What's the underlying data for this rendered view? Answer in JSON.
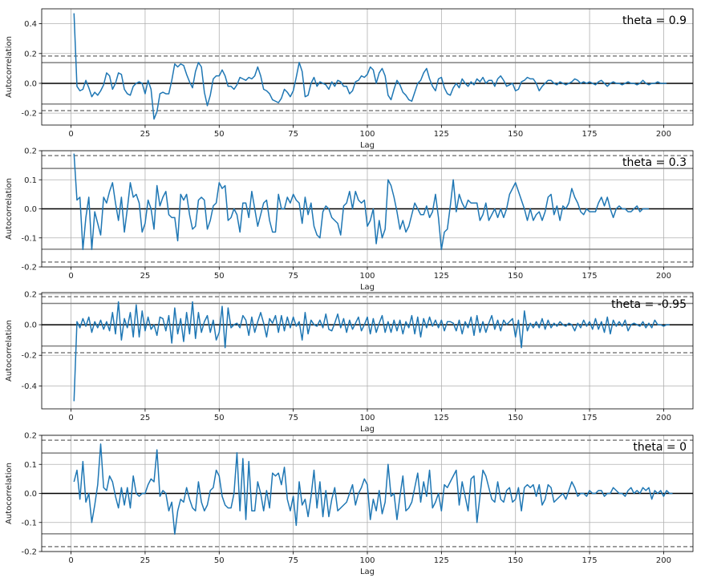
{
  "chart_data": [
    {
      "type": "line",
      "annotation": "theta = 0.9",
      "xlabel": "Lag",
      "ylabel": "Autocorrelation",
      "xlim": [
        -9.9,
        209.9
      ],
      "ylim": [
        -0.28,
        0.5
      ],
      "xticks": [
        "0",
        "25",
        "50",
        "75",
        "100",
        "125",
        "150",
        "175",
        "200"
      ],
      "yticks": [
        "-0.2",
        "0.0",
        "0.2",
        "0.4"
      ],
      "ytick_values": [
        -0.2,
        0.0,
        0.2,
        0.4
      ],
      "confidence_lines": {
        "solid": 0.139,
        "dashed": 0.183
      },
      "grid": true,
      "series": [
        {
          "color": "#1f77b4",
          "values": [
            0.47,
            -0.02,
            -0.05,
            -0.04,
            0.02,
            -0.03,
            -0.09,
            -0.06,
            -0.08,
            -0.05,
            -0.01,
            0.07,
            0.05,
            -0.04,
            0.0,
            0.07,
            0.06,
            -0.04,
            -0.07,
            -0.08,
            -0.02,
            0.0,
            0.01,
            0.0,
            -0.07,
            0.02,
            -0.04,
            -0.24,
            -0.19,
            -0.07,
            -0.06,
            -0.07,
            -0.07,
            0.02,
            0.13,
            0.11,
            0.13,
            0.12,
            0.06,
            0.01,
            -0.03,
            0.08,
            0.14,
            0.11,
            -0.06,
            -0.15,
            -0.08,
            0.03,
            0.05,
            0.05,
            0.09,
            0.05,
            -0.02,
            -0.02,
            -0.04,
            -0.01,
            0.04,
            0.03,
            0.02,
            0.04,
            0.03,
            0.05,
            0.11,
            0.05,
            -0.04,
            -0.05,
            -0.07,
            -0.11,
            -0.12,
            -0.13,
            -0.1,
            -0.04,
            -0.06,
            -0.09,
            -0.05,
            0.04,
            0.14,
            0.08,
            -0.09,
            -0.08,
            0.0,
            0.04,
            -0.02,
            0.01,
            0.0,
            -0.01,
            -0.04,
            0.01,
            -0.02,
            0.02,
            0.01,
            -0.02,
            -0.02,
            -0.07,
            -0.05,
            0.01,
            0.02,
            0.05,
            0.04,
            0.06,
            0.11,
            0.09,
            0.0,
            0.07,
            0.1,
            0.05,
            -0.08,
            -0.11,
            -0.04,
            0.02,
            -0.01,
            -0.06,
            -0.08,
            -0.11,
            -0.12,
            -0.06,
            0.0,
            0.02,
            0.07,
            0.1,
            0.03,
            -0.02,
            -0.05,
            0.03,
            0.04,
            -0.03,
            -0.07,
            -0.08,
            -0.03,
            0.0,
            -0.03,
            0.03,
            0.0,
            -0.02,
            0.01,
            -0.01,
            0.03,
            0.01,
            0.04,
            0.0,
            0.02,
            0.02,
            -0.02,
            0.03,
            0.05,
            0.02,
            -0.02,
            -0.01,
            0.0,
            -0.05,
            -0.04,
            0.01,
            0.02,
            0.04,
            0.03,
            0.03,
            0.0,
            -0.05,
            -0.02,
            0.0,
            0.02,
            0.02,
            0.0,
            -0.01,
            0.01,
            0.0,
            -0.01,
            0.0,
            0.01,
            0.03,
            0.02,
            0.0,
            0.01,
            0.0,
            0.01,
            0.0,
            -0.01,
            0.01,
            0.02,
            0.0,
            -0.02,
            0.0,
            0.01,
            0.0,
            0.0,
            -0.01,
            0.0,
            0.01,
            0.0,
            0.0,
            -0.01,
            0.0,
            0.02,
            0.0,
            -0.01,
            0.0,
            0.0,
            0.01,
            0.0,
            0.0,
            0.0
          ]
        }
      ]
    },
    {
      "type": "line",
      "annotation": "theta = 0.3",
      "xlabel": "Lag",
      "ylabel": "Autocorrelation",
      "xlim": [
        -9.9,
        209.9
      ],
      "ylim": [
        -0.2,
        0.2
      ],
      "xticks": [
        "0",
        "25",
        "50",
        "75",
        "100",
        "125",
        "150",
        "175",
        "200"
      ],
      "yticks": [
        "-0.2",
        "-0.1",
        "0.0",
        "0.1",
        "0.2"
      ],
      "ytick_values": [
        -0.2,
        -0.1,
        0.0,
        0.1,
        0.2
      ],
      "confidence_lines": {
        "solid": 0.139,
        "dashed": 0.183
      },
      "grid": true,
      "series": [
        {
          "color": "#1f77b4",
          "values": [
            0.19,
            0.03,
            0.04,
            -0.14,
            -0.03,
            0.04,
            -0.14,
            -0.01,
            -0.05,
            -0.09,
            0.04,
            0.02,
            0.06,
            0.09,
            0.02,
            -0.04,
            0.04,
            -0.08,
            0.0,
            0.09,
            0.04,
            0.05,
            0.02,
            -0.08,
            -0.05,
            0.03,
            0.0,
            -0.07,
            0.08,
            0.01,
            0.04,
            0.06,
            -0.02,
            -0.03,
            -0.03,
            -0.11,
            0.05,
            0.03,
            0.05,
            -0.02,
            -0.07,
            -0.06,
            0.03,
            0.04,
            0.03,
            -0.07,
            -0.04,
            0.01,
            0.02,
            0.09,
            0.07,
            0.08,
            -0.04,
            -0.03,
            0.0,
            -0.02,
            -0.08,
            0.02,
            0.02,
            -0.03,
            0.06,
            0.0,
            -0.06,
            -0.02,
            0.02,
            0.03,
            -0.04,
            -0.08,
            -0.08,
            0.05,
            0.0,
            0.0,
            0.04,
            0.02,
            0.05,
            0.03,
            0.02,
            -0.05,
            0.04,
            -0.02,
            0.02,
            -0.06,
            -0.09,
            -0.1,
            -0.01,
            0.01,
            0.0,
            -0.03,
            -0.04,
            -0.05,
            -0.09,
            0.01,
            0.02,
            0.06,
            0.0,
            0.06,
            0.03,
            0.02,
            0.03,
            -0.06,
            -0.04,
            0.0,
            -0.12,
            -0.04,
            -0.1,
            -0.07,
            0.1,
            0.08,
            0.04,
            -0.01,
            -0.07,
            -0.04,
            -0.08,
            -0.06,
            -0.02,
            0.02,
            0.0,
            -0.02,
            -0.02,
            0.01,
            -0.03,
            -0.01,
            0.05,
            -0.03,
            -0.14,
            -0.08,
            -0.07,
            0.01,
            0.1,
            -0.01,
            0.05,
            0.02,
            0.0,
            0.03,
            0.02,
            0.02,
            0.02,
            -0.04,
            -0.02,
            0.02,
            -0.04,
            -0.02,
            0.0,
            -0.03,
            0.0,
            -0.03,
            0.0,
            0.05,
            0.07,
            0.09,
            0.06,
            0.03,
            0.0,
            -0.04,
            0.0,
            -0.04,
            -0.02,
            -0.01,
            -0.04,
            -0.01,
            0.04,
            0.05,
            -0.02,
            0.01,
            -0.04,
            0.01,
            0.0,
            0.02,
            0.07,
            0.04,
            0.02,
            -0.01,
            -0.02,
            0.0,
            -0.01,
            -0.01,
            -0.01,
            0.02,
            0.04,
            0.01,
            0.04,
            0.0,
            -0.03,
            0.0,
            0.01,
            0.0,
            0.0,
            -0.01,
            -0.01,
            0.0,
            0.01,
            -0.01,
            0.0,
            0.0,
            0.0
          ]
        }
      ]
    },
    {
      "type": "line",
      "annotation": "theta = -0.95",
      "xlabel": "Lag",
      "ylabel": "Autocorrelation",
      "xlim": [
        -9.9,
        209.9
      ],
      "ylim": [
        -0.55,
        0.21
      ],
      "xticks": [
        "0",
        "25",
        "50",
        "75",
        "100",
        "125",
        "150",
        "175",
        "200"
      ],
      "yticks": [
        "-0.4",
        "-0.2",
        "0.0",
        "0.2"
      ],
      "ytick_values": [
        -0.4,
        -0.2,
        0.0,
        0.2
      ],
      "confidence_lines": {
        "solid": 0.139,
        "dashed": 0.183
      },
      "grid": true,
      "series": [
        {
          "color": "#1f77b4",
          "values": [
            -0.5,
            0.02,
            -0.02,
            0.04,
            -0.01,
            0.05,
            -0.05,
            0.02,
            -0.02,
            0.03,
            -0.03,
            0.02,
            -0.04,
            0.08,
            -0.06,
            0.15,
            -0.1,
            0.04,
            -0.02,
            0.08,
            -0.08,
            0.13,
            -0.08,
            0.09,
            -0.04,
            0.05,
            -0.03,
            0.0,
            -0.07,
            0.05,
            0.04,
            -0.04,
            0.06,
            -0.12,
            0.11,
            -0.06,
            0.04,
            -0.11,
            0.08,
            -0.06,
            0.15,
            -0.09,
            0.08,
            -0.05,
            0.02,
            0.06,
            -0.05,
            0.03,
            -0.1,
            -0.05,
            0.12,
            -0.15,
            0.11,
            -0.02,
            0.0,
            0.01,
            -0.02,
            0.06,
            0.03,
            -0.07,
            0.05,
            -0.05,
            0.02,
            0.08,
            0.01,
            -0.08,
            0.04,
            0.01,
            0.06,
            -0.05,
            0.06,
            -0.04,
            0.05,
            -0.02,
            0.05,
            -0.01,
            0.02,
            -0.1,
            0.08,
            -0.06,
            0.03,
            0.0,
            -0.01,
            0.03,
            -0.02,
            0.07,
            -0.03,
            -0.04,
            0.01,
            0.07,
            -0.02,
            0.04,
            -0.05,
            0.03,
            -0.03,
            0.01,
            0.05,
            -0.04,
            0.0,
            0.05,
            -0.06,
            0.04,
            -0.05,
            0.01,
            0.06,
            -0.05,
            0.02,
            -0.05,
            0.03,
            -0.04,
            0.03,
            -0.06,
            0.02,
            -0.02,
            0.06,
            -0.06,
            0.05,
            -0.08,
            0.04,
            -0.02,
            0.05,
            -0.01,
            0.03,
            -0.02,
            0.03,
            -0.04,
            0.02,
            0.02,
            0.01,
            -0.04,
            0.03,
            -0.06,
            0.02,
            -0.02,
            0.05,
            -0.07,
            0.06,
            -0.05,
            0.02,
            -0.05,
            0.01,
            0.06,
            -0.03,
            0.03,
            -0.04,
            0.03,
            0.0,
            0.02,
            0.04,
            -0.08,
            0.03,
            -0.15,
            0.09,
            -0.04,
            0.01,
            -0.02,
            0.02,
            -0.02,
            0.04,
            -0.03,
            0.03,
            -0.02,
            0.01,
            -0.01,
            0.02,
            0.0,
            -0.01,
            0.01,
            0.0,
            -0.04,
            0.01,
            -0.02,
            0.03,
            -0.01,
            0.02,
            -0.03,
            0.04,
            -0.03,
            0.02,
            -0.05,
            0.05,
            -0.06,
            0.03,
            -0.01,
            0.02,
            -0.01,
            0.03,
            -0.04,
            0.0,
            0.01,
            0.0,
            -0.01,
            0.02,
            -0.02,
            0.01,
            -0.02,
            0.03,
            0.0,
            0.0,
            -0.01,
            0.0,
            0.0
          ]
        }
      ]
    },
    {
      "type": "line",
      "annotation": "theta = 0",
      "xlabel": "Lag",
      "ylabel": "Autocorrelation",
      "xlim": [
        -9.9,
        209.9
      ],
      "ylim": [
        -0.2,
        0.2
      ],
      "xticks": [
        "0",
        "25",
        "50",
        "75",
        "100",
        "125",
        "150",
        "175",
        "200"
      ],
      "yticks": [
        "-0.2",
        "-0.1",
        "0.0",
        "0.1",
        "0.2"
      ],
      "ytick_values": [
        -0.2,
        -0.1,
        0.0,
        0.1,
        0.2
      ],
      "confidence_lines": {
        "solid": 0.139,
        "dashed": 0.183
      },
      "grid": true,
      "series": [
        {
          "color": "#1f77b4",
          "values": [
            0.04,
            0.08,
            -0.02,
            0.11,
            -0.03,
            0.0,
            -0.1,
            -0.04,
            0.03,
            0.17,
            0.02,
            0.01,
            0.06,
            0.04,
            -0.01,
            -0.05,
            0.02,
            -0.04,
            0.02,
            -0.05,
            0.06,
            0.0,
            -0.01,
            0.0,
            0.0,
            0.03,
            0.05,
            0.04,
            0.15,
            -0.01,
            0.01,
            0.0,
            -0.06,
            -0.03,
            -0.14,
            -0.06,
            -0.02,
            -0.03,
            0.02,
            -0.02,
            -0.05,
            -0.06,
            0.04,
            -0.03,
            -0.06,
            -0.04,
            0.01,
            0.02,
            0.08,
            0.06,
            -0.01,
            -0.04,
            -0.05,
            -0.05,
            0.0,
            0.14,
            -0.06,
            0.12,
            -0.09,
            0.11,
            -0.06,
            -0.06,
            0.04,
            0.0,
            -0.06,
            0.01,
            -0.05,
            0.07,
            0.06,
            0.07,
            0.03,
            0.09,
            -0.02,
            -0.06,
            -0.01,
            -0.11,
            0.04,
            -0.04,
            -0.02,
            -0.08,
            -0.01,
            0.08,
            -0.05,
            0.04,
            -0.08,
            0.01,
            -0.08,
            -0.02,
            0.02,
            -0.06,
            -0.05,
            -0.04,
            -0.03,
            0.0,
            0.03,
            -0.04,
            0.0,
            0.02,
            0.05,
            0.03,
            -0.09,
            -0.02,
            -0.06,
            0.01,
            -0.07,
            -0.03,
            0.1,
            -0.01,
            0.0,
            -0.09,
            -0.01,
            0.06,
            -0.06,
            -0.05,
            -0.03,
            0.02,
            0.07,
            -0.03,
            0.04,
            -0.01,
            0.08,
            -0.05,
            -0.03,
            0.0,
            -0.06,
            0.03,
            0.02,
            0.04,
            0.06,
            0.08,
            -0.04,
            0.04,
            -0.01,
            -0.06,
            0.05,
            0.06,
            -0.1,
            -0.01,
            0.08,
            0.06,
            0.02,
            -0.02,
            -0.03,
            0.04,
            -0.02,
            -0.03,
            0.01,
            0.02,
            -0.03,
            -0.02,
            0.02,
            -0.06,
            0.02,
            0.03,
            0.02,
            0.03,
            -0.01,
            0.03,
            -0.04,
            -0.02,
            0.03,
            0.02,
            -0.03,
            -0.02,
            -0.01,
            0.0,
            -0.02,
            0.01,
            0.04,
            0.02,
            -0.01,
            0.0,
            0.0,
            -0.01,
            0.01,
            0.0,
            0.0,
            0.01,
            0.01,
            -0.01,
            0.0,
            0.0,
            0.02,
            0.01,
            0.0,
            0.0,
            -0.01,
            0.01,
            0.02,
            0.0,
            0.01,
            0.0,
            0.02,
            0.01,
            0.02,
            -0.02,
            0.01,
            0.0,
            0.01,
            -0.01,
            0.01,
            0.0,
            0.0
          ]
        }
      ]
    }
  ]
}
